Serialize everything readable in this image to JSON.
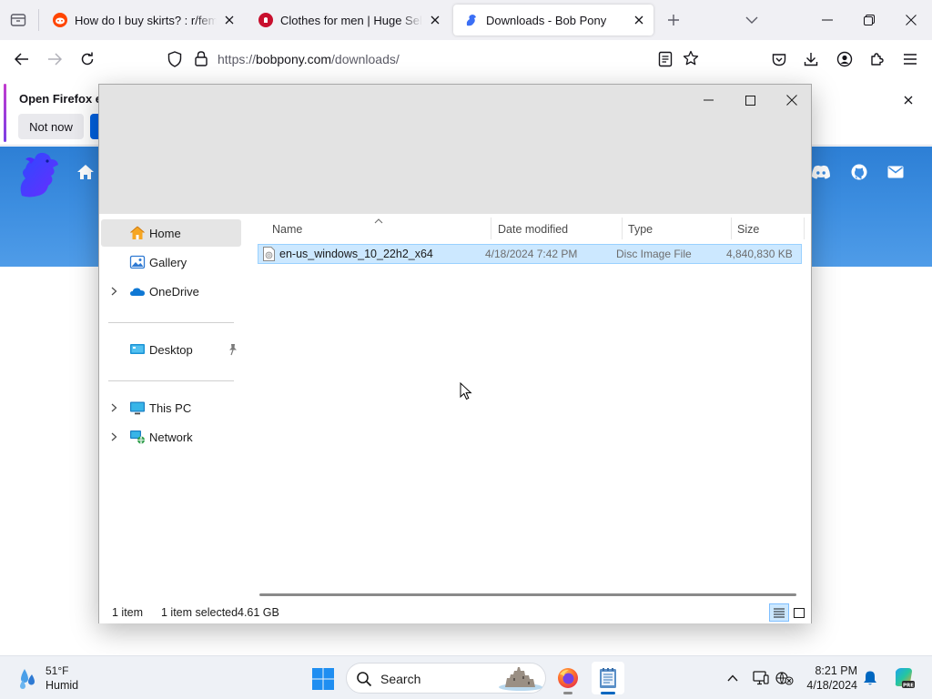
{
  "browser": {
    "tabs": [
      {
        "title": "How do I buy skirts? : r/feminin",
        "favicon_color": "#ff4500"
      },
      {
        "title": "Clothes for men | Huge Selectio",
        "favicon_color": "#c8102e"
      },
      {
        "title": "Downloads - Bob Pony",
        "favicon_color": "#3b6ff5",
        "active": true
      }
    ],
    "url": {
      "scheme": "https://",
      "host": "bobpony.com",
      "path": "/downloads/"
    },
    "notification": {
      "title": "Open Firefox ev",
      "not_now_label": "Not now",
      "primary_color": "#0061e0"
    }
  },
  "website": {
    "header_color": "#3a8be0",
    "nav_icons": [
      "home-icon",
      "discord-icon",
      "github-icon",
      "email-icon"
    ]
  },
  "explorer": {
    "nav_items": [
      {
        "label": "Home",
        "icon": "home-icon",
        "selected": true
      },
      {
        "label": "Gallery",
        "icon": "gallery-icon"
      },
      {
        "label": "OneDrive",
        "icon": "onedrive-icon",
        "expandable": true
      },
      {
        "label": "Desktop",
        "icon": "desktop-icon",
        "pinned": true
      },
      {
        "label": "This PC",
        "icon": "this-pc-icon",
        "expandable": true
      },
      {
        "label": "Network",
        "icon": "network-icon",
        "expandable": true
      }
    ],
    "columns": {
      "name": "Name",
      "date_modified": "Date modified",
      "type": "Type",
      "size": "Size"
    },
    "files": [
      {
        "name": "en-us_windows_10_22h2_x64",
        "date_modified": "4/18/2024 7:42 PM",
        "type": "Disc Image File",
        "size": "4,840,830 KB",
        "selected": true
      }
    ],
    "status": {
      "item_count": "1 item",
      "selection": "1 item selected",
      "selection_size": "4.61 GB"
    },
    "selection_color": "#cce8ff"
  },
  "taskbar": {
    "weather": {
      "temp": "51°F",
      "condition": "Humid"
    },
    "search_placeholder": "Search",
    "clock": {
      "time": "8:21 PM",
      "date": "4/18/2024"
    },
    "accent_color": "#0067c0"
  }
}
